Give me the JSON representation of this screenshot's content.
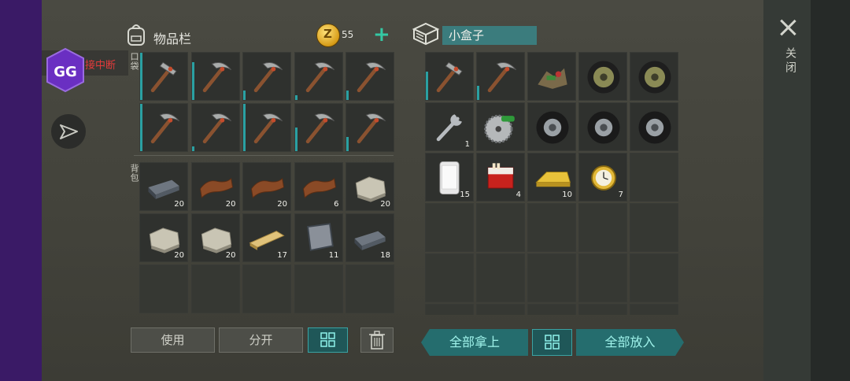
{
  "inventory": {
    "title": "物品栏",
    "coins": "55",
    "coin_symbol": "Z",
    "add_label": "+"
  },
  "box": {
    "title": "小盒子"
  },
  "labels": {
    "pockets": "口袋",
    "backpack": "背包",
    "close": "关闭"
  },
  "overlay": {
    "gg_logo": "GG",
    "gg_status": "接中断"
  },
  "buttons": {
    "use": "使用",
    "split": "分开",
    "take_all": "全部拿上",
    "put_all": "全部放入"
  },
  "pockets": [
    {
      "item": "hammer",
      "durability": 1.0
    },
    {
      "item": "pickaxe",
      "durability": 0.8
    },
    {
      "item": "pickaxe",
      "durability": 0.2
    },
    {
      "item": "pickaxe",
      "durability": 0.1
    },
    {
      "item": "pickaxe",
      "durability": 0.2
    },
    {
      "item": "pickaxe",
      "durability": 1.0
    },
    {
      "item": "pickaxe",
      "durability": 0.1
    },
    {
      "item": "pickaxe",
      "durability": 1.0
    },
    {
      "item": "pickaxe",
      "durability": 0.5
    },
    {
      "item": "pickaxe",
      "durability": 0.3
    }
  ],
  "backpack": [
    {
      "item": "iron-ingot",
      "qty": "20"
    },
    {
      "item": "leather",
      "qty": "20"
    },
    {
      "item": "leather",
      "qty": "20"
    },
    {
      "item": "leather",
      "qty": "6"
    },
    {
      "item": "stone",
      "qty": "20"
    },
    {
      "item": "stone",
      "qty": "20"
    },
    {
      "item": "stone",
      "qty": "20"
    },
    {
      "item": "plank",
      "qty": "17"
    },
    {
      "item": "metal-plate",
      "qty": "11"
    },
    {
      "item": "iron-ingot",
      "qty": "18"
    },
    {
      "item": "",
      "qty": ""
    },
    {
      "item": "",
      "qty": ""
    },
    {
      "item": "",
      "qty": ""
    },
    {
      "item": "",
      "qty": ""
    },
    {
      "item": "",
      "qty": ""
    }
  ],
  "box_items": [
    {
      "item": "hammer",
      "qty": "",
      "durability": 0.6
    },
    {
      "item": "pickaxe",
      "qty": "",
      "durability": 0.3
    },
    {
      "item": "scrap",
      "qty": ""
    },
    {
      "item": "wheel",
      "qty": ""
    },
    {
      "item": "wheel",
      "qty": ""
    },
    {
      "item": "wrench",
      "qty": "1"
    },
    {
      "item": "saw-blade",
      "qty": ""
    },
    {
      "item": "tire",
      "qty": ""
    },
    {
      "item": "tire",
      "qty": ""
    },
    {
      "item": "tire",
      "qty": ""
    },
    {
      "item": "phone",
      "qty": "15"
    },
    {
      "item": "cigarettes",
      "qty": "4"
    },
    {
      "item": "gold-bar",
      "qty": "10"
    },
    {
      "item": "gold-watch",
      "qty": "7"
    },
    {
      "item": "",
      "qty": ""
    },
    {
      "item": "",
      "qty": ""
    },
    {
      "item": "",
      "qty": ""
    },
    {
      "item": "",
      "qty": ""
    },
    {
      "item": "",
      "qty": ""
    },
    {
      "item": "",
      "qty": ""
    },
    {
      "item": "",
      "qty": ""
    },
    {
      "item": "",
      "qty": ""
    },
    {
      "item": "",
      "qty": ""
    },
    {
      "item": "",
      "qty": ""
    },
    {
      "item": "",
      "qty": ""
    },
    {
      "item": "",
      "qty": ""
    },
    {
      "item": "",
      "qty": ""
    },
    {
      "item": "",
      "qty": ""
    },
    {
      "item": "",
      "qty": ""
    },
    {
      "item": "",
      "qty": ""
    }
  ]
}
